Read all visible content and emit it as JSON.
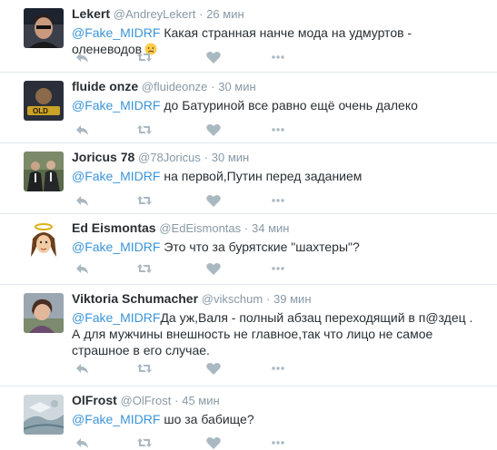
{
  "tweets": [
    {
      "fullname": "Lekert",
      "username": "@AndreyLekert",
      "time": "26 мин",
      "mention": "@Fake_MIDRF",
      "text": "Какая странная нанче мода на удмуртов - оленеводов",
      "emoji": "sad-face-emoji",
      "avatar": "lekert-avatar"
    },
    {
      "fullname": "fluide onze",
      "username": "@fluideonze",
      "time": "30 мин",
      "mention": "@Fake_MIDRF",
      "text": "до Батуриной все равно ещё очень далеко",
      "avatar": "fluide-onze-avatar"
    },
    {
      "fullname": "Joricus 78",
      "username": "@78Joricus",
      "time": "30 мин",
      "mention": "@Fake_MIDRF",
      "text": "на первой,Путин перед заданием",
      "avatar": "joricus-avatar"
    },
    {
      "fullname": "Ed Eismontas",
      "username": "@EdEismontas",
      "time": "34 мин",
      "mention": "@Fake_MIDRF",
      "text": "Это что за бурятские \"шахтеры\"?",
      "avatar": "ed-eismontas-avatar"
    },
    {
      "fullname": "Viktoria Schumacher",
      "username": "@vikschum",
      "time": "39 мин",
      "mention": "@Fake_MIDRF",
      "text": "Да уж,Валя - полный абзац переходящий в п@здец . А для мужчины внешность не главное,так что лицо не самое страшное в его случае.",
      "avatar": "viktoria-avatar"
    },
    {
      "fullname": "OlFrost",
      "username": "@OlFrost",
      "time": "45 мин",
      "mention": "@Fake_MIDRF",
      "text": "шо за бабище?",
      "avatar": "olfrost-avatar"
    }
  ],
  "separator": "·",
  "colors": {
    "mention": "#3b94d9",
    "meta": "#8899a6",
    "text": "#292f33",
    "icon": "#aab8c2",
    "border": "#e1e8ed"
  },
  "icons": {
    "reply": "reply-icon",
    "retweet": "retweet-icon",
    "like": "heart-icon",
    "more": "more-dots-icon"
  }
}
